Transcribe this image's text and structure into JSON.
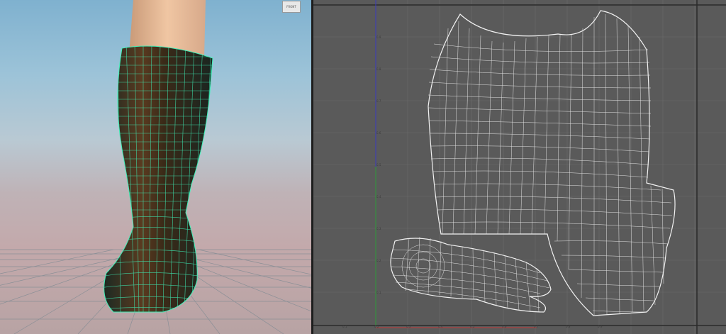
{
  "viewport": {
    "view_label": "FRONT",
    "grid_color": "#8a8f96",
    "wire_color": "#3ff0b8"
  },
  "uv_editor": {
    "background": "#5a5a5a",
    "wire_color": "#f2f2f2",
    "grid_color": "#6c6c6c",
    "v_axis_color": "#3a3ac0",
    "u_axis_color": "#c03a3a",
    "v_ticks": [
      "0.9",
      "0.8",
      "0.7",
      "0.6",
      "0.5",
      "0.4",
      "0.3",
      "0.2",
      "0.1"
    ],
    "u_ticks": [
      "0.1",
      "0.2",
      "0.3",
      "0.4",
      "0.5",
      "0.6",
      "0.7",
      "0.8",
      "0.9"
    ]
  }
}
